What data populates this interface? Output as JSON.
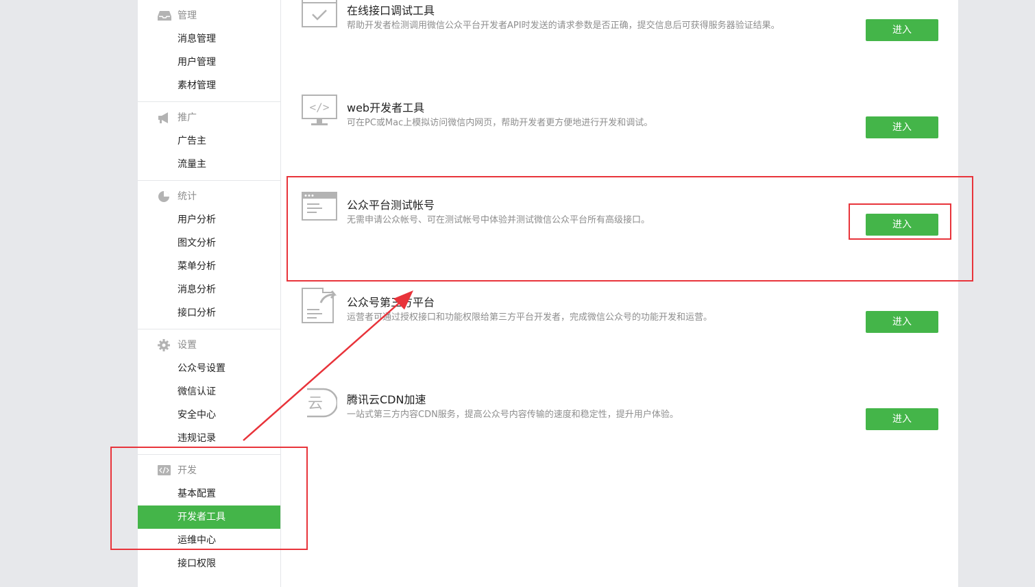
{
  "sidebar": {
    "groups": [
      {
        "title": "管理",
        "icon": "inbox-icon",
        "items": [
          "消息管理",
          "用户管理",
          "素材管理"
        ]
      },
      {
        "title": "推广",
        "icon": "megaphone-icon",
        "items": [
          "广告主",
          "流量主"
        ]
      },
      {
        "title": "统计",
        "icon": "pie-chart-icon",
        "items": [
          "用户分析",
          "图文分析",
          "菜单分析",
          "消息分析",
          "接口分析"
        ]
      },
      {
        "title": "设置",
        "icon": "gear-icon",
        "items": [
          "公众号设置",
          "微信认证",
          "安全中心",
          "违规记录"
        ]
      },
      {
        "title": "开发",
        "icon": "code-icon",
        "items": [
          "基本配置",
          "开发者工具",
          "运维中心",
          "接口权限"
        ]
      }
    ],
    "active_item": "开发者工具"
  },
  "tools": [
    {
      "title": "在线接口调试工具",
      "desc": "帮助开发者检测调用微信公众平台开发者API时发送的请求参数是否正确，提交信息后可获得服务器验证结果。",
      "button": "进入",
      "icon": "checklist-window-icon"
    },
    {
      "title": "web开发者工具",
      "desc": "可在PC或Mac上模拟访问微信内网页，帮助开发者更方便地进行开发和调试。",
      "button": "进入",
      "icon": "code-monitor-icon"
    },
    {
      "title": "公众平台测试帐号",
      "desc": "无需申请公众帐号、可在测试帐号中体验并测试微信公众平台所有高级接口。",
      "button": "进入",
      "icon": "browser-window-icon"
    },
    {
      "title": "公众号第三方平台",
      "desc": "运营者可通过授权接口和功能权限给第三方平台开发者，完成微信公众号的功能开发和运营。",
      "button": "进入",
      "icon": "document-share-icon"
    },
    {
      "title": "腾讯云CDN加速",
      "desc": "一站式第三方内容CDN服务，提高公众号内容传输的速度和稳定性，提升用户体验。",
      "button": "进入",
      "icon": "cloud-cdn-icon"
    }
  ],
  "colors": {
    "accent_green": "#44b549",
    "annotation_red": "#e8333a",
    "muted_text": "#8d8d8d",
    "icon_gray": "#b3b3b3"
  }
}
